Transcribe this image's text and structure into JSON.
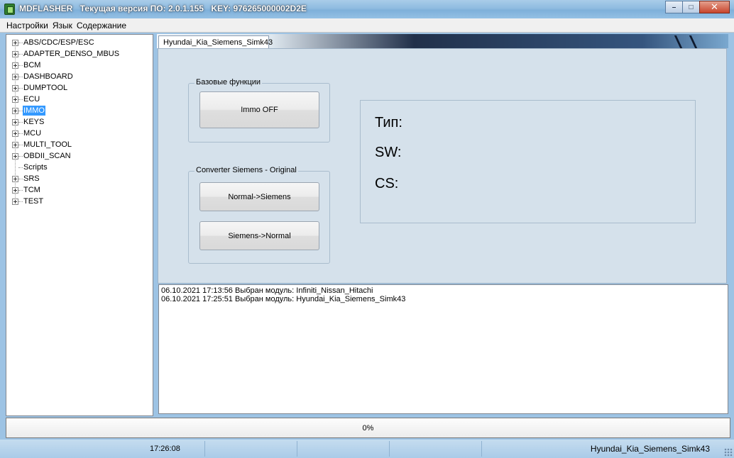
{
  "window": {
    "app_name": "MDFLASHER",
    "version_text": "Текущая версия ПО: 2.0.1.155",
    "key_text": "KEY: 976265000002D2E",
    "minimize_glyph": "–",
    "maximize_glyph": "□",
    "close_glyph": "✕"
  },
  "menu": {
    "items": [
      "Настройки",
      "Язык",
      "Содержание"
    ]
  },
  "tree": {
    "items": [
      {
        "label": "ABS/CDC/ESP/ESC",
        "expandable": true
      },
      {
        "label": "ADAPTER_DENSO_MBUS",
        "expandable": true
      },
      {
        "label": "BCM",
        "expandable": true
      },
      {
        "label": "DASHBOARD",
        "expandable": true
      },
      {
        "label": "DUMPTOOL",
        "expandable": true
      },
      {
        "label": "ECU",
        "expandable": true
      },
      {
        "label": "IMMO",
        "expandable": true,
        "selected": true
      },
      {
        "label": "KEYS",
        "expandable": true
      },
      {
        "label": "MCU",
        "expandable": true
      },
      {
        "label": "MULTI_TOOL",
        "expandable": true
      },
      {
        "label": "OBDII_SCAN",
        "expandable": true
      },
      {
        "label": "Scripts",
        "expandable": false
      },
      {
        "label": "SRS",
        "expandable": true
      },
      {
        "label": "TCM",
        "expandable": true
      },
      {
        "label": "TEST",
        "expandable": true
      }
    ]
  },
  "tab": {
    "label": "Hyundai_Kia_Siemens_Simk43"
  },
  "basic": {
    "legend": "Базовые функции",
    "immo_off": "Immo OFF"
  },
  "converter": {
    "legend": "Converter Siemens - Original",
    "to_siemens": "Normal->Siemens",
    "to_normal": "Siemens->Normal"
  },
  "info": {
    "type_label": "Тип:",
    "sw_label": "SW:",
    "cs_label": "CS:"
  },
  "log": {
    "lines": [
      "06.10.2021 17:13:56  Выбран модуль:  Infiniti_Nissan_Hitachi",
      "06.10.2021 17:25:51  Выбран модуль:  Hyundai_Kia_Siemens_Simk43"
    ]
  },
  "progress": {
    "value": 0,
    "text": "0%"
  },
  "status": {
    "time": "17:26:08",
    "module": "Hyundai_Kia_Siemens_Simk43"
  },
  "colors": {
    "selection": "#3399ff",
    "panel_bg": "#d5e1eb",
    "progress_fill": "#37c34a"
  }
}
